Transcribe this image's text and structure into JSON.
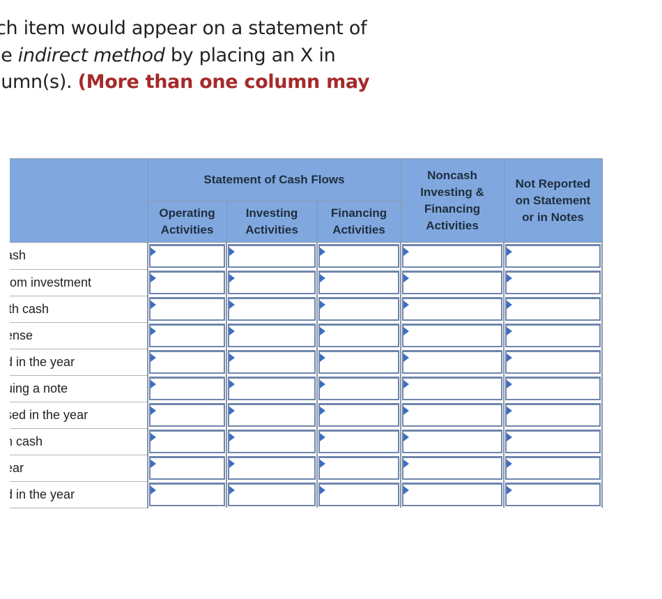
{
  "instructions": {
    "line1": "ch item would appear on a statement of",
    "line2_pre": "ie ",
    "line2_italic": "indirect method",
    "line2_post": " by placing an X in",
    "line3_pre": "lumn(s). ",
    "line3_emph": "(More than one column may"
  },
  "table": {
    "group_header": "Statement of Cash Flows",
    "columns": [
      {
        "key": "operating",
        "label_line1": "Operating",
        "label_line2": "Activities"
      },
      {
        "key": "investing",
        "label_line1": "Investing",
        "label_line2": "Activities"
      },
      {
        "key": "financing",
        "label_line1": "Financing",
        "label_line2": "Activities"
      },
      {
        "key": "noncash",
        "label_lines": [
          "Noncash",
          "Investing &",
          "Financing",
          "Activities"
        ]
      },
      {
        "key": "not_reported",
        "label_lines": [
          "Not Reported",
          "on Statement",
          "or in Notes"
        ]
      }
    ],
    "rows": [
      {
        "label": "ash",
        "values": [
          "",
          "",
          "",
          "",
          ""
        ]
      },
      {
        "label": "rom investment",
        "values": [
          "",
          "",
          "",
          "",
          ""
        ]
      },
      {
        "label": "ith cash",
        "values": [
          "",
          "",
          "",
          "",
          ""
        ]
      },
      {
        "label": "ense",
        "values": [
          "",
          "",
          "",
          "",
          ""
        ]
      },
      {
        "label": "d in the year",
        "values": [
          "",
          "",
          "",
          "",
          ""
        ]
      },
      {
        "label": "uing a note",
        "values": [
          "",
          "",
          "",
          "",
          ""
        ]
      },
      {
        "label": "sed in the year",
        "values": [
          "",
          "",
          "",
          "",
          ""
        ]
      },
      {
        "label": "n cash",
        "values": [
          "",
          "",
          "",
          "",
          ""
        ]
      },
      {
        "label": "ear",
        "values": [
          "",
          "",
          "",
          "",
          ""
        ]
      },
      {
        "label": "d in the year",
        "values": [
          "",
          "",
          "",
          "",
          ""
        ]
      }
    ]
  },
  "colors": {
    "header_bg": "#80a8df",
    "emphasis": "#a52a2a",
    "dropdown_marker": "#3e6ec2"
  }
}
